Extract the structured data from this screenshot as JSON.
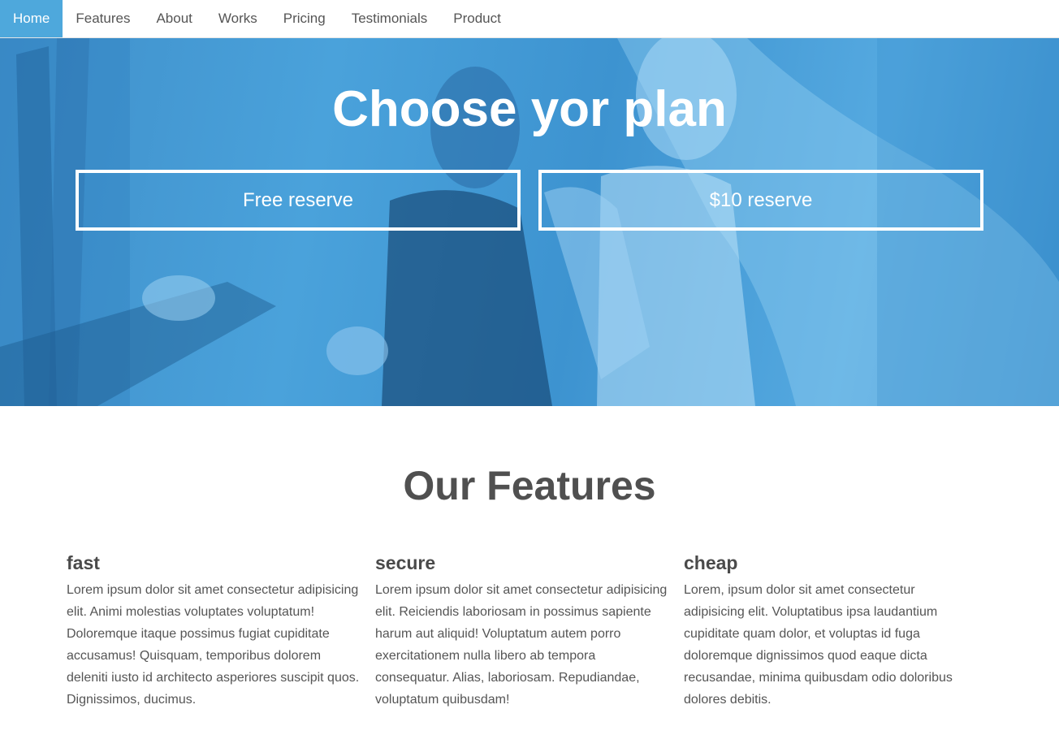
{
  "nav": {
    "items": [
      {
        "label": "Home",
        "active": true
      },
      {
        "label": "Features",
        "active": false
      },
      {
        "label": "About",
        "active": false
      },
      {
        "label": "Works",
        "active": false
      },
      {
        "label": "Pricing",
        "active": false
      },
      {
        "label": "Testimonials",
        "active": false
      },
      {
        "label": "Product",
        "active": false
      }
    ]
  },
  "hero": {
    "title": "Choose yor plan",
    "free_button": "Free reserve",
    "paid_button": "$10 reserve",
    "overlay_color": "#4aa2db"
  },
  "features": {
    "title": "Our Features",
    "items": [
      {
        "heading": "fast",
        "text": "Lorem ipsum dolor sit amet consectetur adipisicing elit. Animi molestias voluptates voluptatum! Doloremque itaque possimus fugiat cupiditate accusamus! Quisquam, temporibus dolorem deleniti iusto id architecto asperiores suscipit quos. Dignissimos, ducimus."
      },
      {
        "heading": "secure",
        "text": "Lorem ipsum dolor sit amet consectetur adipisicing elit. Reiciendis laboriosam in possimus sapiente harum aut aliquid! Voluptatum autem porro exercitationem nulla libero ab tempora consequatur. Alias, laboriosam. Repudiandae, voluptatum quibusdam!"
      },
      {
        "heading": "cheap",
        "text": "Lorem, ipsum dolor sit amet consectetur adipisicing elit. Voluptatibus ipsa laudantium cupiditate quam dolor, et voluptas id fuga doloremque dignissimos quod eaque dicta recusandae, minima quibusdam odio doloribus dolores debitis."
      }
    ]
  },
  "colors": {
    "accent": "#4ea8dc",
    "text": "#555555",
    "heading": "#505050"
  }
}
